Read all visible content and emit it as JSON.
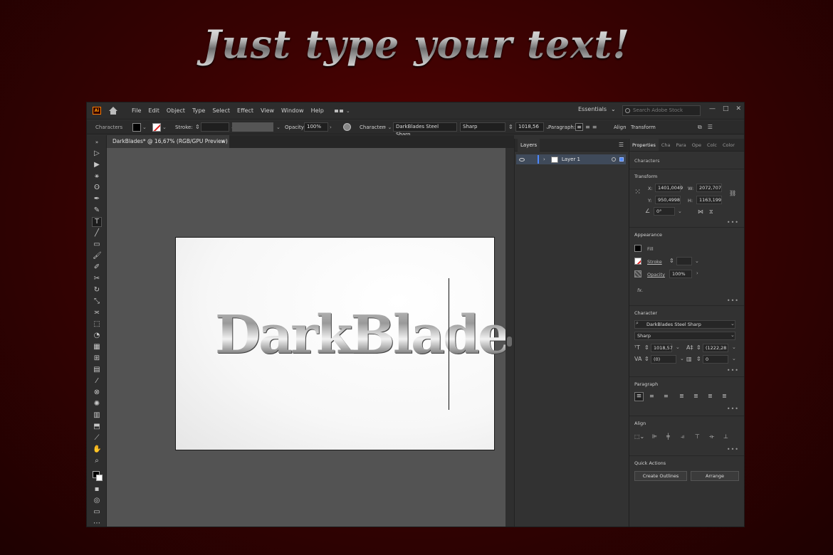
{
  "headline": "Just type your text!",
  "app": {
    "logo": "Ai",
    "menu": [
      "File",
      "Edit",
      "Object",
      "Type",
      "Select",
      "Effect",
      "View",
      "Window",
      "Help"
    ],
    "workspace": "Essentials",
    "search_placeholder": "Search Adobe Stock",
    "window_controls": [
      "—",
      "□",
      "✕"
    ]
  },
  "control_bar": {
    "panel_label": "Characters",
    "stroke_label": "Stroke:",
    "opacity_label": "Opacity:",
    "opacity_value": "100%",
    "character_label": "Character:",
    "font_family": "DarkBlades Steel Sharp",
    "font_style": "Sharp",
    "font_size": "1018,56",
    "paragraph_label": "Paragraph:",
    "align_label": "Align",
    "transform_label": "Transform"
  },
  "document": {
    "tab_title": "DarkBlades* @ 16,67% (RGB/GPU Preview)",
    "tab_close": "×",
    "artboard_text": "DarkBlades"
  },
  "layers_panel": {
    "title": "Layers",
    "layers": [
      {
        "name": "Layer 1"
      }
    ]
  },
  "properties_panel": {
    "tabs": [
      "Properties",
      "Cha",
      "Para",
      "Ope",
      "Colc",
      "Color"
    ],
    "selection": "Characters",
    "transform": {
      "title": "Transform",
      "x_label": "X:",
      "x": "1401,0049",
      "y_label": "Y:",
      "y": "950,4998",
      "w_label": "W:",
      "w": "2072,707",
      "h_label": "H:",
      "h": "1163,199",
      "angle": "0°"
    },
    "appearance": {
      "title": "Appearance",
      "fill_label": "Fill",
      "stroke_label": "Stroke",
      "opacity_label": "Opacity",
      "opacity_value": "100%",
      "fx_label": "fx."
    },
    "character": {
      "title": "Character",
      "font_family": "DarkBlades Steel Sharp",
      "font_style": "Sharp",
      "font_size": "1018,57",
      "leading": "(1222,28",
      "kerning": "(0)",
      "tracking": "0"
    },
    "paragraph": {
      "title": "Paragraph"
    },
    "align": {
      "title": "Align"
    },
    "quick_actions": {
      "title": "Quick Actions",
      "create_outlines": "Create Outlines",
      "arrange": "Arrange"
    },
    "more": "•••"
  }
}
